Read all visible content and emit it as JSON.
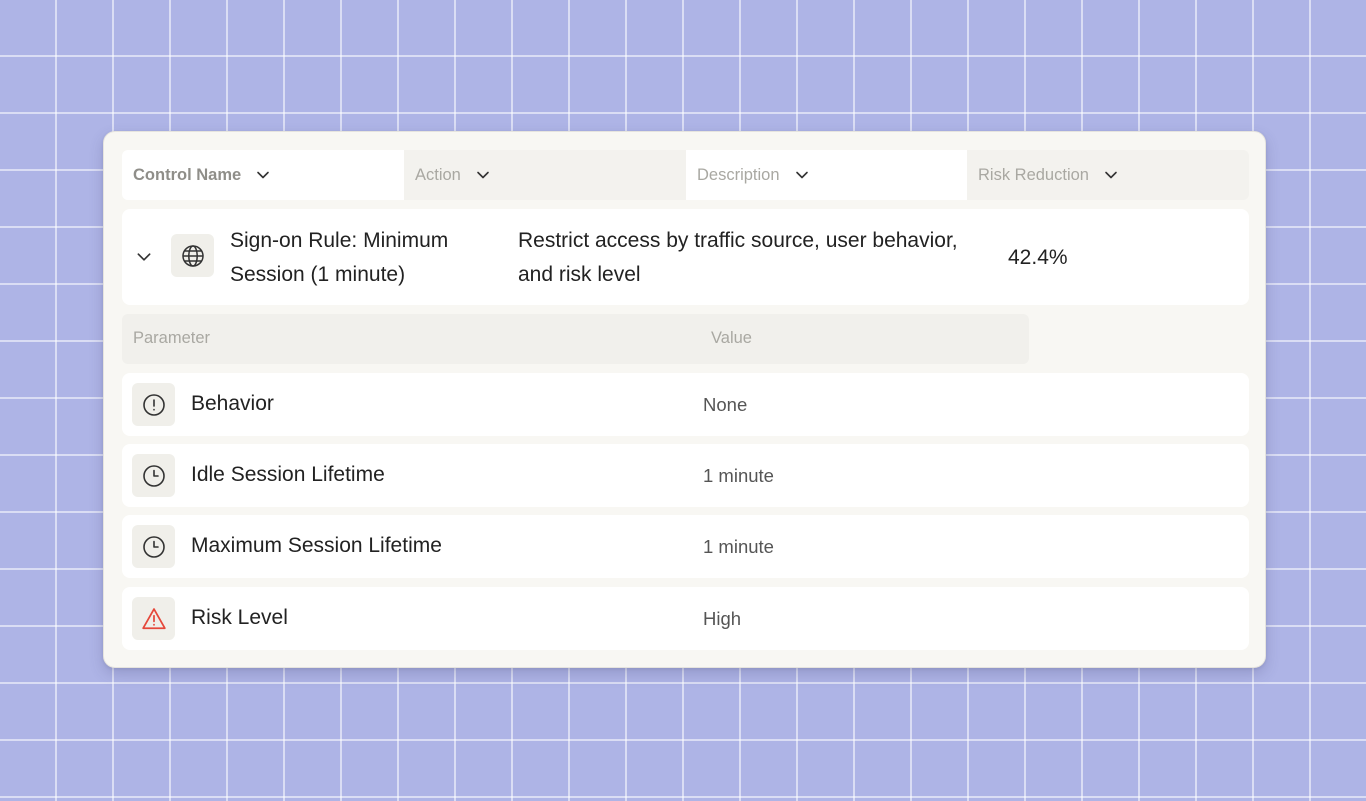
{
  "table": {
    "headers": [
      {
        "label": "Control Name",
        "icon": "chevron-down-icon"
      },
      {
        "label": "Action",
        "icon": "chevron-down-icon"
      },
      {
        "label": "Description",
        "icon": "chevron-down-icon"
      },
      {
        "label": "Risk Reduction",
        "icon": "chevron-down-icon"
      }
    ],
    "control": {
      "name": "Sign-on Rule: Minimum Session (1 minute)",
      "icon": "globe-icon",
      "description": "Restrict access by traffic source, user behavior, and risk level",
      "risk_reduction": "42.4%"
    },
    "parameters": {
      "header_parameter": "Parameter",
      "header_value": "Value",
      "rows": [
        {
          "name": "Behavior",
          "value": "None",
          "icon": "alert-circle-icon"
        },
        {
          "name": "Idle Session Lifetime",
          "value": "1 minute",
          "icon": "clock-icon"
        },
        {
          "name": "Maximum Session Lifetime",
          "value": "1 minute",
          "icon": "clock-icon"
        },
        {
          "name": "Risk Level",
          "value": "High",
          "icon": "warning-triangle-icon",
          "icon_color": "#e5483b"
        }
      ]
    }
  }
}
